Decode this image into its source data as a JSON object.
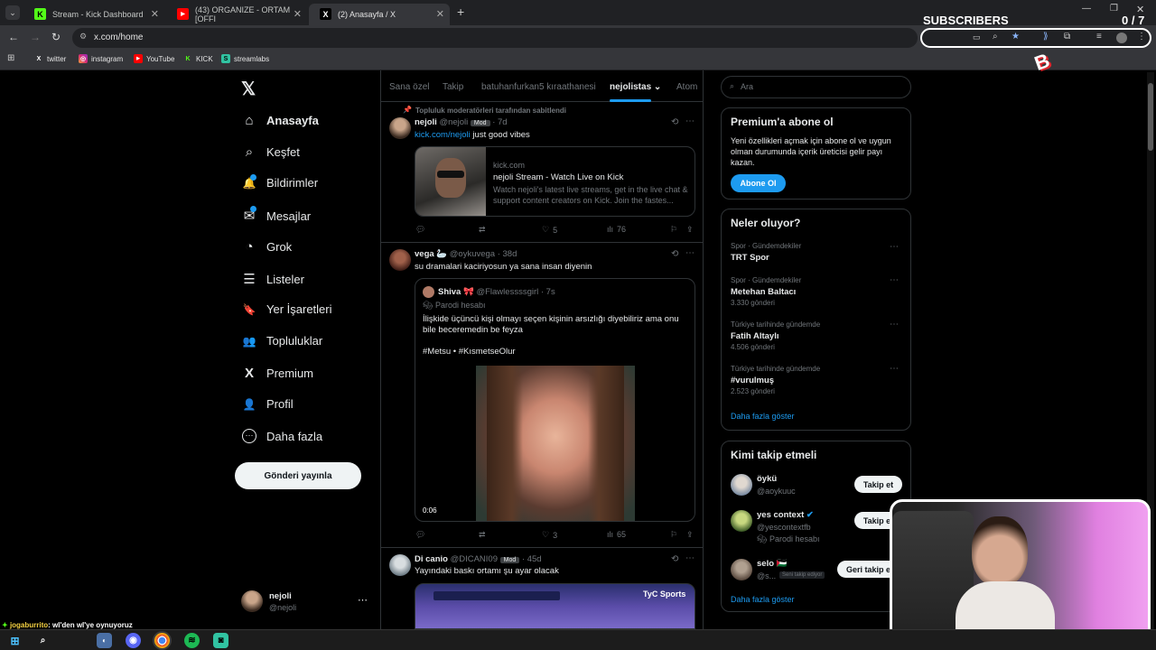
{
  "browser": {
    "tabs": [
      {
        "title": "Stream - Kick Dashboard",
        "icon": "K"
      },
      {
        "title": "(43) ORGANIZE - ORTAM [OFFI",
        "icon": "▶"
      },
      {
        "title": "(2) Anasayfa / X",
        "icon": "X"
      }
    ],
    "url": "x.com/home",
    "bookmarks": [
      "twitter",
      "instagram",
      "YouTube",
      "KICK",
      "streamlabs"
    ]
  },
  "overlay": {
    "subscribers_label": "SUBSCRIBERS",
    "subscribers_count": "0 / 7",
    "chat_user": "jogaburrito",
    "chat_message": ": wl'den wl'ye oynuyoruz"
  },
  "sidebar": {
    "items": [
      {
        "label": "Anasayfa",
        "icon": "⌂"
      },
      {
        "label": "Keşfet",
        "icon": "⌕"
      },
      {
        "label": "Bildirimler",
        "icon": "🔔"
      },
      {
        "label": "Mesajlar",
        "icon": "✉"
      },
      {
        "label": "Grok",
        "icon": "◔"
      },
      {
        "label": "Listeler",
        "icon": "☰"
      },
      {
        "label": "Yer İşaretleri",
        "icon": "🔖"
      },
      {
        "label": "Topluluklar",
        "icon": "👥"
      },
      {
        "label": "Premium",
        "icon": "X"
      },
      {
        "label": "Profil",
        "icon": "👤"
      },
      {
        "label": "Daha fazla",
        "icon": "⋯"
      }
    ],
    "post_button": "Gönderi yayınla",
    "account_name": "nejoli",
    "account_handle": "@nejoli"
  },
  "feed": {
    "tabs": [
      "Sana özel",
      "Takip",
      "batuhanfurkan5 kıraathanesi",
      "nejolistas",
      "Atom"
    ],
    "pinned_label": "Topluluk moderatörleri tarafından sabitlendi",
    "tweets": [
      {
        "name": "nejoli",
        "handle": "@nejoli",
        "badge": "Mod",
        "time": "· 7d",
        "link": "kick.com/nejoli",
        "text": " just good vibes",
        "card_domain": "kick.com",
        "card_title": "nejoli Stream - Watch Live on Kick",
        "card_desc": "Watch nejoli's latest live streams, get in the live chat & support content creators on Kick. Join the fastes...",
        "likes": "5",
        "views": "76"
      },
      {
        "name": "vega 🦢",
        "handle": "@oykuvega",
        "time": "· 38d",
        "text": "su dramalari kaciriyosun ya sana insan diyenin",
        "quote_name": "Shiva 🎀",
        "quote_handle": "@Flawlessssgirl",
        "quote_time": "· 7s",
        "quote_label": "Parodi hesabı",
        "quote_text": "İlişkide üçüncü kişi olmayı seçen kişinin arsızlığı diyebiliriz ama onu bile beceremedin be feyza",
        "quote_tags": "#Metsu • #KısmetseOlur",
        "video_time": "0:06",
        "likes": "3",
        "views": "65"
      },
      {
        "name": "Di canio",
        "handle": "@DICANI09",
        "badge": "Mod",
        "time": "· 45d",
        "text": "Yayındaki baskı ortamı şu ayar olacak",
        "media_label": "TyC Sports"
      }
    ]
  },
  "right": {
    "search_placeholder": "Ara",
    "premium": {
      "title": "Premium'a abone ol",
      "text": "Yeni özellikleri açmak için abone ol ve uygun olman durumunda içerik üreticisi gelir payı kazan.",
      "button": "Abone Ol"
    },
    "trends_title": "Neler oluyor?",
    "trends": [
      {
        "category": "Spor · Gündemdekiler",
        "name": "TRT Spor",
        "count": ""
      },
      {
        "category": "Spor · Gündemdekiler",
        "name": "Metehan Baltacı",
        "count": "3.330 gönderi"
      },
      {
        "category": "Türkiye tarihinde gündemde",
        "name": "Fatih Altaylı",
        "count": "4.506 gönderi"
      },
      {
        "category": "Türkiye tarihinde gündemde",
        "name": "#vurulmuş",
        "count": "2.523 gönderi"
      }
    ],
    "show_more": "Daha fazla göster",
    "who_title": "Kimi takip etmeli",
    "who": [
      {
        "name": "öykü",
        "handle": "@aoykuuc",
        "button": "Takip et",
        "extra": ""
      },
      {
        "name": "yes context",
        "handle": "@yescontextfb",
        "button": "Takip et",
        "extra": "Parodi hesabı"
      },
      {
        "name": "selo 🇵🇸",
        "handle": "@s...",
        "button": "Geri takip et",
        "extra": "Seni takip ediyor"
      }
    ],
    "show_more2": "Daha fazla göster"
  },
  "colors": {
    "accent": "#1d9bf0",
    "kick": "#53fc18",
    "bg": "#000000",
    "border": "#2f3336"
  }
}
